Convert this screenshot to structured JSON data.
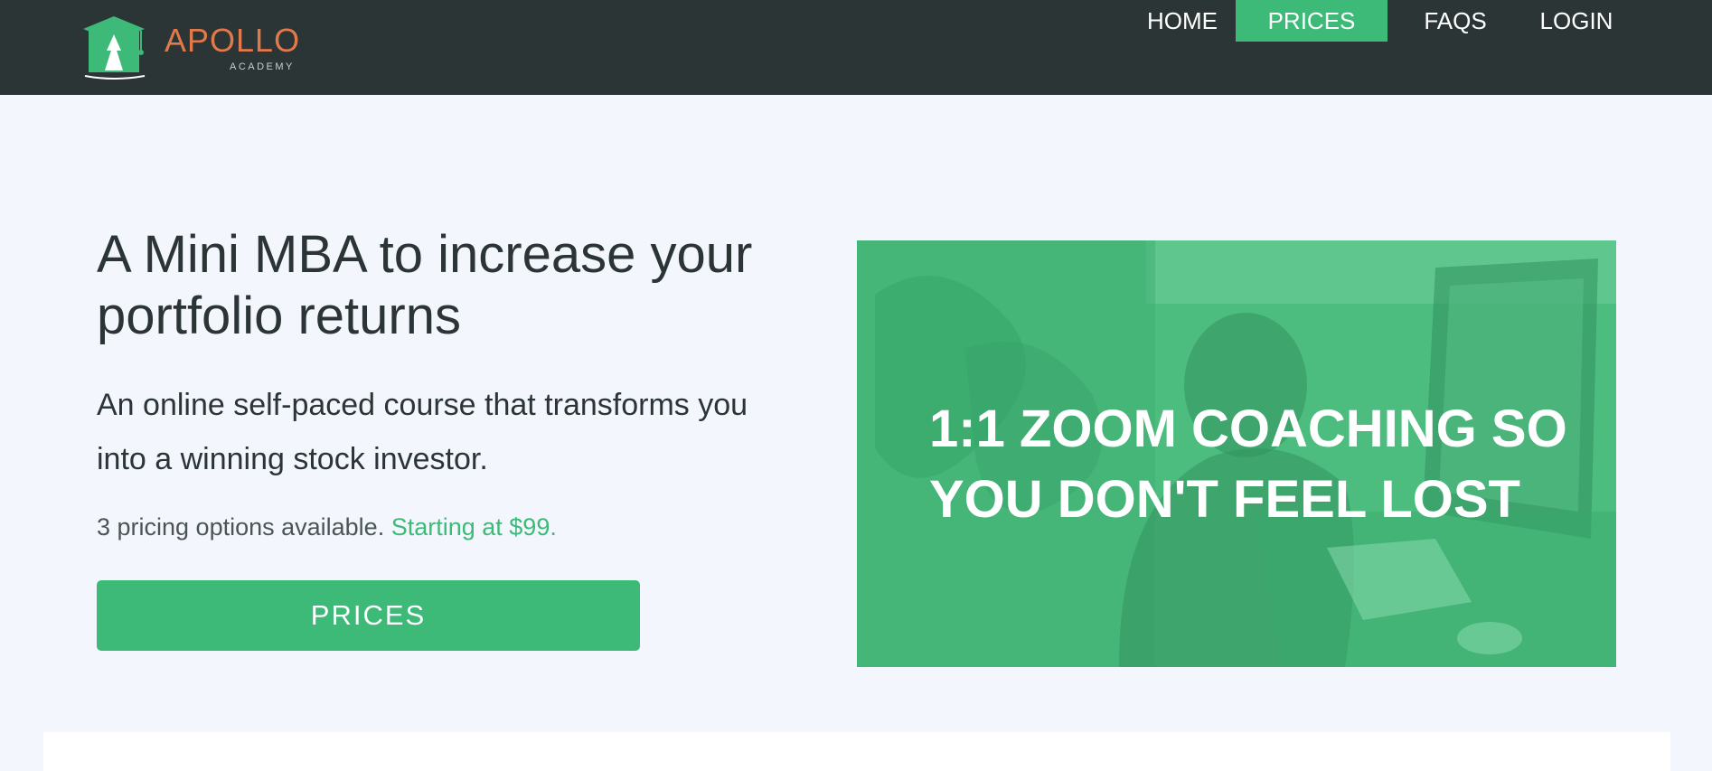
{
  "brand": {
    "name": "APOLLO",
    "tagline": "ACADEMY",
    "name_color": "#e2794a",
    "icon": "graduation-cap-arrow-logo"
  },
  "nav": {
    "items": [
      {
        "label": "HOME",
        "active": false
      },
      {
        "label": "PRICES",
        "active": true
      },
      {
        "label": "FAQS",
        "active": false
      },
      {
        "label": "LOGIN",
        "active": false
      }
    ]
  },
  "hero": {
    "title": "A Mini MBA to increase your portfolio returns",
    "subtitle": "An online self-paced course that transforms you into a winning stock investor.",
    "pricing_note": "3 pricing options available.",
    "pricing_highlight": "Starting at $99.",
    "cta_label": "PRICES"
  },
  "promo": {
    "text": "1:1 ZOOM COACHING SO YOU DON'T FEEL LOST"
  },
  "colors": {
    "navbar_bg": "#2b3536",
    "accent": "#3dba78",
    "page_bg": "#f4f6fe",
    "text_dark": "#2b3536"
  }
}
